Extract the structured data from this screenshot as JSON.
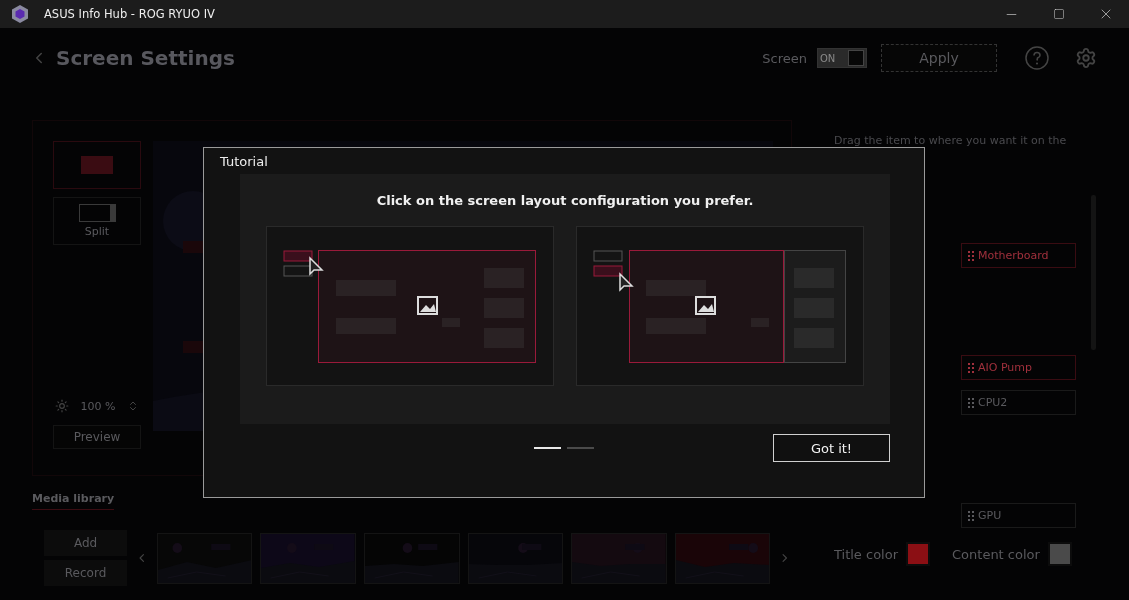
{
  "window": {
    "title": "ASUS Info Hub - ROG RYUO IV"
  },
  "header": {
    "title": "Screen Settings",
    "screen_label": "Screen",
    "toggle_text": "ON",
    "screen_on": true,
    "apply": "Apply"
  },
  "layouts": [
    {
      "kind": "fullscreen",
      "selected": true
    },
    {
      "kind": "split",
      "label": "Split",
      "selected": false
    }
  ],
  "brightness": {
    "value": "100 %"
  },
  "preview_button": "Preview",
  "media": {
    "title": "Media library",
    "buttons": [
      "Add",
      "Record"
    ]
  },
  "right_panel": {
    "hint": "Drag the item to where you want it on the",
    "items": [
      {
        "label": "Motherboard",
        "selected": true
      },
      {
        "label": "AIO Pump",
        "selected": true
      },
      {
        "label": "CPU2",
        "selected": false
      },
      {
        "label": "GPU",
        "selected": false
      }
    ],
    "title_color": {
      "label": "Title color",
      "color": "#8b0f14"
    },
    "content_color": {
      "label": "Content color",
      "color": "#4a4a4a"
    }
  },
  "dialog": {
    "title": "Tutorial",
    "heading": "Click on the screen layout configuration you prefer.",
    "options": [
      {
        "kind": "fullscreen"
      },
      {
        "kind": "split"
      }
    ],
    "pages": [
      {
        "selected": true
      },
      {
        "selected": false
      }
    ],
    "button": "Got it!"
  }
}
